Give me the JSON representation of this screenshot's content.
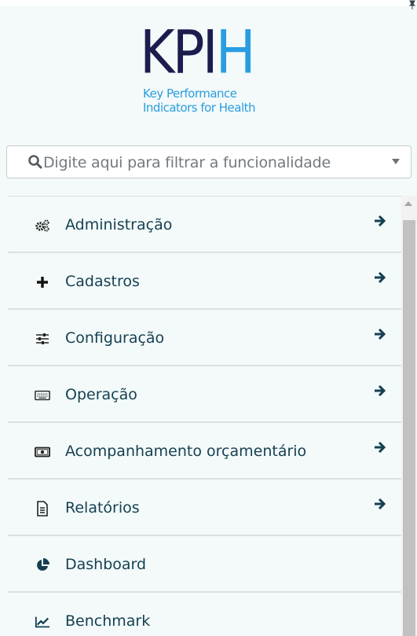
{
  "logo": {
    "word_main": "KPI",
    "word_accent": "H",
    "sub_line1": "Key Performance",
    "sub_line2": "Indicators for Health"
  },
  "search": {
    "placeholder": "Digite aqui para filtrar a funcionalidade",
    "icon": "search-icon"
  },
  "menu": {
    "items": [
      {
        "label": "Administração",
        "icon": "gears-icon",
        "has_arrow": true
      },
      {
        "label": "Cadastros",
        "icon": "plus-icon",
        "has_arrow": true
      },
      {
        "label": "Configuração",
        "icon": "sliders-icon",
        "has_arrow": true
      },
      {
        "label": "Operação",
        "icon": "keyboard-icon",
        "has_arrow": true
      },
      {
        "label": "Acompanhamento orçamentário",
        "icon": "money-icon",
        "has_arrow": true
      },
      {
        "label": "Relatórios",
        "icon": "document-icon",
        "has_arrow": true
      },
      {
        "label": "Dashboard",
        "icon": "pie-chart-icon",
        "has_arrow": false
      },
      {
        "label": "Benchmark",
        "icon": "line-chart-icon",
        "has_arrow": false
      }
    ]
  },
  "colors": {
    "background": "#f3faf9",
    "logo_dark": "#1c1c4e",
    "logo_accent": "#2a9de0",
    "menu_text": "#153f52"
  }
}
